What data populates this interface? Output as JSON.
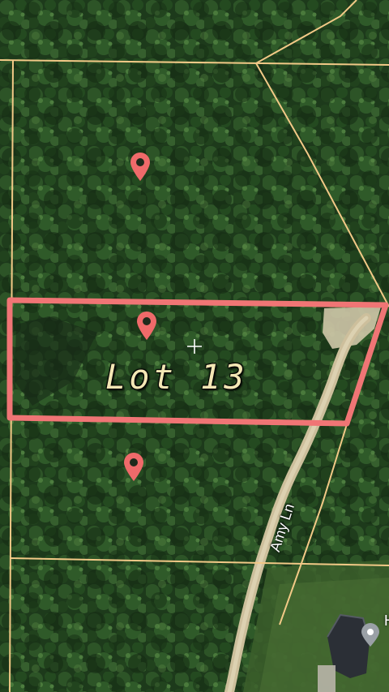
{
  "map": {
    "lot_label": "Lot 13",
    "road_label": "Amy Ln",
    "edge_label": "H",
    "colors": {
      "parcel_line": "#f2c987",
      "lot_outline": "#f07575",
      "pin": "#ef6a6a",
      "road": "#cdbf9c"
    },
    "icons": [
      "location-pin-icon",
      "crosshair-icon",
      "place-marker-icon"
    ]
  }
}
